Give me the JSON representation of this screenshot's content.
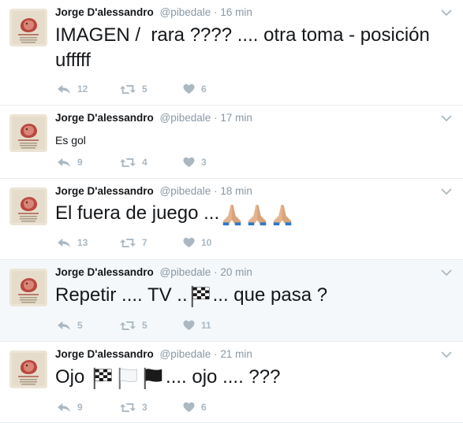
{
  "colors": {
    "name": "#14171a",
    "meta": "#8899a6",
    "action": "#aab8c2",
    "highlight": "#f5f8fa"
  },
  "tweets": [
    {
      "fullname": "Jorge D'alessandro",
      "username": "@pibedale",
      "dot": "·",
      "time": "16 min",
      "text": "IMAGEN /  rara ???? .... otra toma - posición ufffff",
      "replies": "12",
      "retweets": "5",
      "likes": "6"
    },
    {
      "fullname": "Jorge D'alessandro",
      "username": "@pibedale",
      "dot": "·",
      "time": "17 min",
      "text": "Es gol",
      "replies": "9",
      "retweets": "4",
      "likes": "3"
    },
    {
      "fullname": "Jorge D'alessandro",
      "username": "@pibedale",
      "dot": "·",
      "time": "18 min",
      "text": "El fuera de juego ...",
      "emoji": [
        "folded-hands-emoji",
        "folded-hands-emoji",
        "folded-hands-emoji"
      ],
      "replies": "13",
      "retweets": "7",
      "likes": "10"
    },
    {
      "fullname": "Jorge D'alessandro",
      "username": "@pibedale",
      "dot": "·",
      "time": "20 min",
      "text_before": "Repetir .... TV ..",
      "text_after": "... que pasa ?",
      "emoji": [
        "checkered-flag-emoji"
      ],
      "replies": "5",
      "retweets": "5",
      "likes": "11"
    },
    {
      "fullname": "Jorge D'alessandro",
      "username": "@pibedale",
      "dot": "·",
      "time": "21 min",
      "text_before": "Ojo",
      "text_after": ".... ojo .... ???",
      "emoji": [
        "checkered-flag-emoji",
        "white-flag-emoji",
        "black-flag-emoji"
      ],
      "replies": "9",
      "retweets": "3",
      "likes": "6"
    }
  ]
}
